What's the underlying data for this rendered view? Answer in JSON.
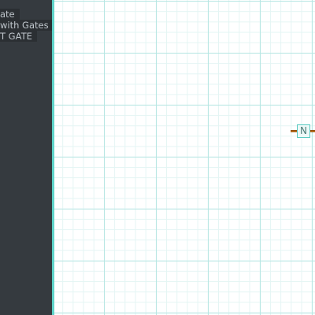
{
  "sidebar": {
    "items": [
      {
        "label": "ate"
      },
      {
        "label": "with Gates"
      },
      {
        "label": "T GATE"
      }
    ]
  },
  "canvas": {
    "gate": {
      "label": "N",
      "type": "not-gate"
    }
  },
  "colors": {
    "sidebar_bg": "#353a3f",
    "accent": "#5fd3c9",
    "grid_major": "#b6e6e3",
    "grid_minor": "#e4f5f4",
    "wire": "#d98a2b"
  }
}
